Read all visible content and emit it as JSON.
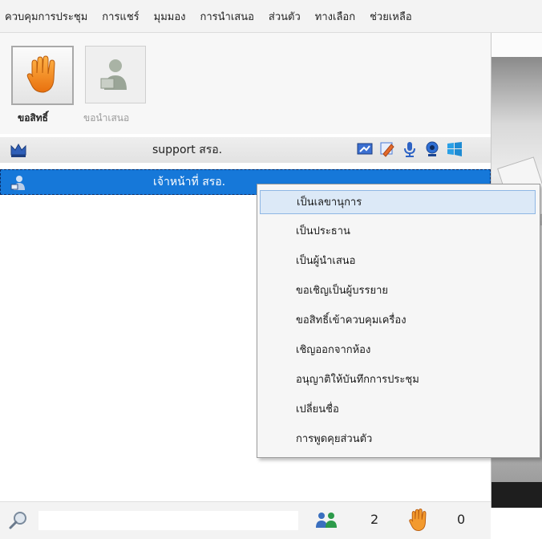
{
  "menubar": {
    "items": [
      "ควบคุมการประชุม",
      "การแชร์",
      "มุมมอง",
      "การนำเสนอ",
      "ส่วนตัว",
      "ทางเลือก",
      "ช่วยเหลือ"
    ]
  },
  "toolbar": {
    "raise_hand_label": "ขอสิทธิ์",
    "request_present_label": "ขอนำเสนอ"
  },
  "participants": [
    {
      "name": "support สรอ.",
      "role_icon": "crown-icon"
    },
    {
      "name": "เจ้าหน้าที่ สรอ.",
      "role_icon": "presenter-icon"
    }
  ],
  "context_menu": {
    "items": [
      "เป็นเลขานุการ",
      "เป็นประธาน",
      "เป็นผู้นำเสนอ",
      "ขอเชิญเป็นผู้บรรยาย",
      "ขอสิทธิ์เข้าควบคุมเครื่อง",
      "เชิญออกจากห้อง",
      "อนุญาติให้บันทึกการประชุม",
      "เปลี่ยนชื่อ",
      "การพูดคุยส่วนตัว"
    ],
    "highlighted_index": 0
  },
  "footer": {
    "search_placeholder": "",
    "participant_count": "2",
    "raised_hand_count": "0"
  },
  "colors": {
    "selection_blue": "#1678d9",
    "menu_highlight": "#dce9f7",
    "hand_orange": "#f08a1c"
  }
}
